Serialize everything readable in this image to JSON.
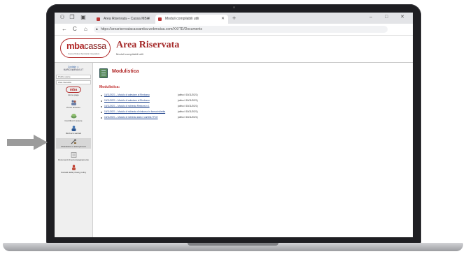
{
  "browser": {
    "tabs": [
      {
        "title": "Area Riservata – Cassa MBA",
        "active": false
      },
      {
        "title": "Moduli compilabili utili",
        "active": true
      }
    ],
    "new_tab": "+",
    "nav": {
      "back": "←",
      "reload": "C"
    },
    "url": "https://areariservatacassamba.webmutua.com/XX/TD/Documents",
    "window_controls": "–  □  ✕"
  },
  "site": {
    "logo": {
      "bold": "mba",
      "light": "cassa",
      "tagline": "Cassa Mutua Sanitaria Integrativa"
    },
    "title": "Area Riservata",
    "subtitle": "Moduli compilabili utili"
  },
  "sidebar": {
    "user_lines": [
      "Cordiale ☺",
      "MARCO@EMAIL.IT"
    ],
    "selects": [
      "Profilo utente",
      "Area riservata"
    ],
    "items": [
      {
        "label": "Home page",
        "icon": "mba-logo-icon"
      },
      {
        "label": "Primo accesso",
        "icon": "people-icon"
      },
      {
        "label": "Contributi / tessere",
        "icon": "coins-icon"
      },
      {
        "label": "Rimborsi sanitari",
        "icon": "person-icon"
      },
      {
        "label": "Modulistica e adempimenti",
        "icon": "tools-icon",
        "active": true
      },
      {
        "label": "Documenti di accompagnamento",
        "icon": "document-icon"
      },
      {
        "label": "Contatti della privacy policy",
        "icon": "contact-icon"
      }
    ]
  },
  "content": {
    "heading": "Modulistica",
    "section": "Modulistica:",
    "documents": [
      {
        "link": "15/11/2021 – Modulo di adesione al Rimborso",
        "date": "(attivo il 15/11/2021)"
      },
      {
        "link": "15/11/2021 – Modulo di adesione al Rimborso",
        "date": "(attivo il 15/11/2021)"
      },
      {
        "link": "15/11/2021 – Modulo di richiesta Rimborsi n.1",
        "date": "(attivo il 15/11/2021)"
      },
      {
        "link": "15/11/2021 – Modulo di richiesta di rimborso in forma indiretta",
        "date": "(attivo il 15/11/2021)"
      },
      {
        "link": "15/11/2021 – Modulo di richiesta stato e cartella TFCE",
        "date": "(attivo il 15/11/2021)"
      }
    ]
  },
  "colors": {
    "brand": "#b22a2a",
    "link": "#1a3f8a",
    "arrow": "#9b9b9b"
  }
}
